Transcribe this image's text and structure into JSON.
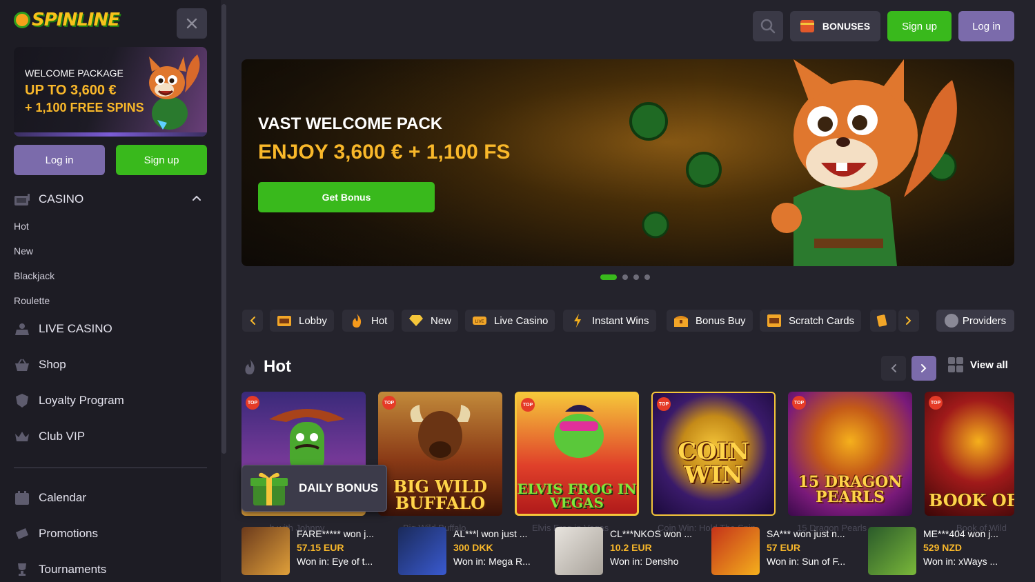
{
  "brand": {
    "logo_text": "SPINLINE"
  },
  "sidebar": {
    "promo": {
      "line1": "WELCOME PACKAGE",
      "line2": "UP TO 3,600 €",
      "line3": "+ 1,100 FREE SPINS"
    },
    "login_label": "Log in",
    "signup_label": "Sign up",
    "casino_label": "CASINO",
    "casino_sub": [
      "Hot",
      "New",
      "Blackjack",
      "Roulette"
    ],
    "items": [
      {
        "label": "LIVE CASINO",
        "icon": "live-casino-icon"
      },
      {
        "label": "Shop",
        "icon": "basket-icon"
      },
      {
        "label": "Loyalty Program",
        "icon": "shield-icon"
      },
      {
        "label": "Club VIP",
        "icon": "crown-icon"
      }
    ],
    "items2": [
      {
        "label": "Calendar",
        "icon": "calendar-icon"
      },
      {
        "label": "Promotions",
        "icon": "ticket-icon"
      },
      {
        "label": "Tournaments",
        "icon": "trophy-icon"
      }
    ]
  },
  "header": {
    "bonuses_label": "BONUSES",
    "signup_label": "Sign up",
    "login_label": "Log in"
  },
  "hero": {
    "title": "VAST WELCOME PACK",
    "subtitle": "ENJOY 3,600 € + 1,100 FS",
    "button": "Get Bonus",
    "slides": 4,
    "active_slide": 1
  },
  "categories": [
    {
      "label": "Lobby",
      "icon": "slot-777-icon"
    },
    {
      "label": "Hot",
      "icon": "flame-icon"
    },
    {
      "label": "New",
      "icon": "diamond-icon"
    },
    {
      "label": "Live Casino",
      "icon": "live-icon"
    },
    {
      "label": "Instant Wins",
      "icon": "lightning-icon"
    },
    {
      "label": "Bonus Buy",
      "icon": "chest-icon"
    },
    {
      "label": "Scratch Cards",
      "icon": "scratch-card-icon"
    }
  ],
  "providers_label": "Providers",
  "hot": {
    "title": "Hot",
    "view_all": "View all",
    "badge": "TOP",
    "games": [
      {
        "title": "",
        "bg": "#4a2a7a"
      },
      {
        "title": "BIG WILD BUFFALO",
        "bg": "#7a3a18"
      },
      {
        "title": "ELVIS FROG IN VEGAS",
        "bg": "#c4261f"
      },
      {
        "title": "COIN WIN",
        "bg": "#2a1458"
      },
      {
        "title": "15 DRAGON PEARLS",
        "bg": "#7a1a7a"
      },
      {
        "title": "BOOK OF W",
        "bg": "#5a0e0e"
      }
    ],
    "ghost_titles": [
      "...h with Johnny",
      "Big Wild Buffalo",
      "Elvis Frog in Vegas",
      "Coin Win: Hold The Spin",
      "15 Dragon Pearls",
      "Book of Wild"
    ]
  },
  "daily_bonus": "DAILY BONUS",
  "winners": [
    {
      "name": "FARE***** won j...",
      "amount": "57.15 EUR",
      "game": "Won in: Eye of t...",
      "thumb": "#6b3a1c"
    },
    {
      "name": "AL***l won just ...",
      "amount": "300 DKK",
      "game": "Won in: Mega R...",
      "thumb": "#1a2a5a"
    },
    {
      "name": "CL***NKOS won ...",
      "amount": "10.2 EUR",
      "game": "Won in: Densho",
      "thumb": "#d6d2cc"
    },
    {
      "name": "SA*** won just n...",
      "amount": "57 EUR",
      "game": "Won in: Sun of F...",
      "thumb": "#c4321a"
    },
    {
      "name": "ME***404 won j...",
      "amount": "529 NZD",
      "game": "Won in: xWays ...",
      "thumb": "#2a5a2a"
    }
  ]
}
